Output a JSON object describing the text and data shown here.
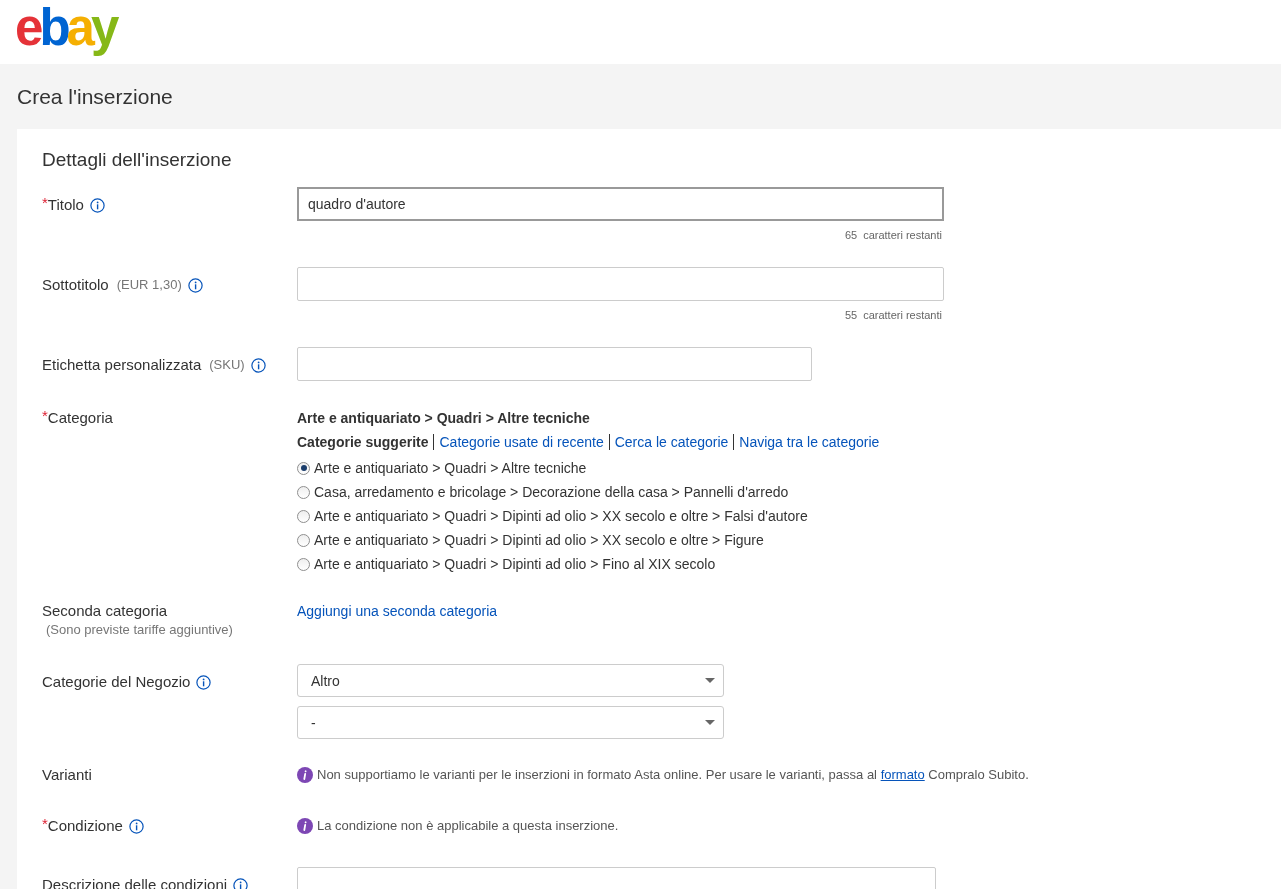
{
  "header": {
    "logo": {
      "letters": [
        {
          "char": "e",
          "color": "#e53238"
        },
        {
          "char": "b",
          "color": "#0064d2"
        },
        {
          "char": "a",
          "color": "#f5af02"
        },
        {
          "char": "y",
          "color": "#86b817"
        }
      ]
    }
  },
  "page_title": "Crea l'inserzione",
  "section_title": "Dettagli dell'inserzione",
  "rows": [
    {
      "kind": "text",
      "marker": "*",
      "label": "Titolo",
      "info": true,
      "value": "quadro d'autore",
      "focused": true,
      "wide": true,
      "counter": "65",
      "counter_text": "caratteri restanti"
    },
    {
      "kind": "text",
      "label": "Sottotitolo",
      "note": "(EUR 1,30)",
      "info": true,
      "value": "",
      "focused": false,
      "wide": true,
      "counter": "55",
      "counter_text": "caratteri restanti"
    },
    {
      "kind": "text",
      "label": "Etichetta personalizzata",
      "note": "(SKU)",
      "info": true,
      "value": "",
      "focused": false,
      "wide": false
    },
    {
      "kind": "category",
      "marker": "*",
      "label": "Categoria",
      "info": false,
      "current": "Arte e antiquariato > Quadri > Altre tecniche",
      "tabs": [
        {
          "label": "Categorie suggerite",
          "selected": true
        },
        {
          "label": "Categorie usate di recente",
          "selected": false
        },
        {
          "label": "Cerca le categorie",
          "selected": false
        },
        {
          "label": "Naviga tra le categorie",
          "selected": false
        }
      ],
      "options": [
        {
          "label": "Arte e antiquariato > Quadri > Altre tecniche",
          "selected": true
        },
        {
          "label": "Casa, arredamento e bricolage > Decorazione della casa > Pannelli d'arredo",
          "selected": false
        },
        {
          "label": "Arte e antiquariato > Quadri > Dipinti ad olio > XX secolo e oltre > Falsi d'autore",
          "selected": false
        },
        {
          "label": "Arte e antiquariato > Quadri > Dipinti ad olio > XX secolo e oltre > Figure",
          "selected": false
        },
        {
          "label": "Arte e antiquariato > Quadri > Dipinti ad olio > Fino al XIX secolo",
          "selected": false
        }
      ]
    },
    {
      "kind": "link",
      "label": "Seconda categoria",
      "subnote": "(Sono previste tariffe aggiuntive)",
      "info": false,
      "link": "Aggiungi una seconda categoria"
    },
    {
      "kind": "selects",
      "label": "Categorie del Negozio",
      "info": true,
      "selects": [
        {
          "value": "Altro"
        },
        {
          "value": "-"
        }
      ]
    },
    {
      "kind": "notice",
      "label": "Varianti",
      "info": false,
      "text": "Non supportiamo le varianti per le inserzioni in formato Asta online. Per usare le varianti, passa al",
      "link": "formato",
      "text_after": "Compralo Subito."
    },
    {
      "kind": "notice",
      "marker": "*",
      "label": "Condizione",
      "info": true,
      "text": "La condizione non è applicabile a questa inserzione."
    },
    {
      "kind": "text",
      "label": "Descrizione delle condizioni",
      "info": true,
      "value": "",
      "focused": false,
      "wide": true,
      "narrow_right": true
    }
  ]
}
